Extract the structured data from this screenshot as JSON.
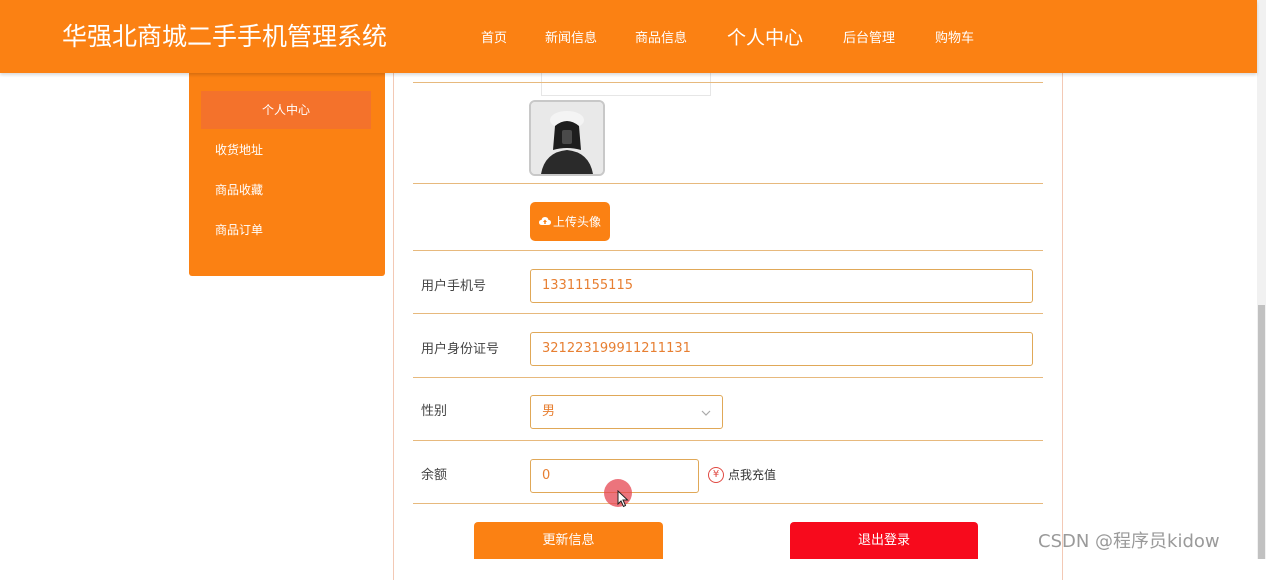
{
  "header": {
    "brand": "华强北商城二手手机管理系统",
    "nav": [
      "首页",
      "新闻信息",
      "商品信息",
      "个人中心",
      "后台管理",
      "购物车"
    ],
    "active_nav": "个人中心"
  },
  "sidebar": {
    "items": [
      "个人中心",
      "收货地址",
      "商品收藏",
      "商品订单"
    ]
  },
  "form": {
    "upload_label": "上传头像",
    "phone_label": "用户手机号",
    "phone_value": "13311155115",
    "id_label": "用户身份证号",
    "id_value": "321223199911211131",
    "gender_label": "性别",
    "gender_value": "男",
    "balance_label": "余额",
    "balance_value": "0",
    "recharge_label": "点我充值",
    "update_label": "更新信息",
    "logout_label": "退出登录"
  },
  "watermark": "CSDN @程序员kidow",
  "colors": {
    "brand_orange": "#fb8113",
    "logout_red": "#f70a1c"
  }
}
